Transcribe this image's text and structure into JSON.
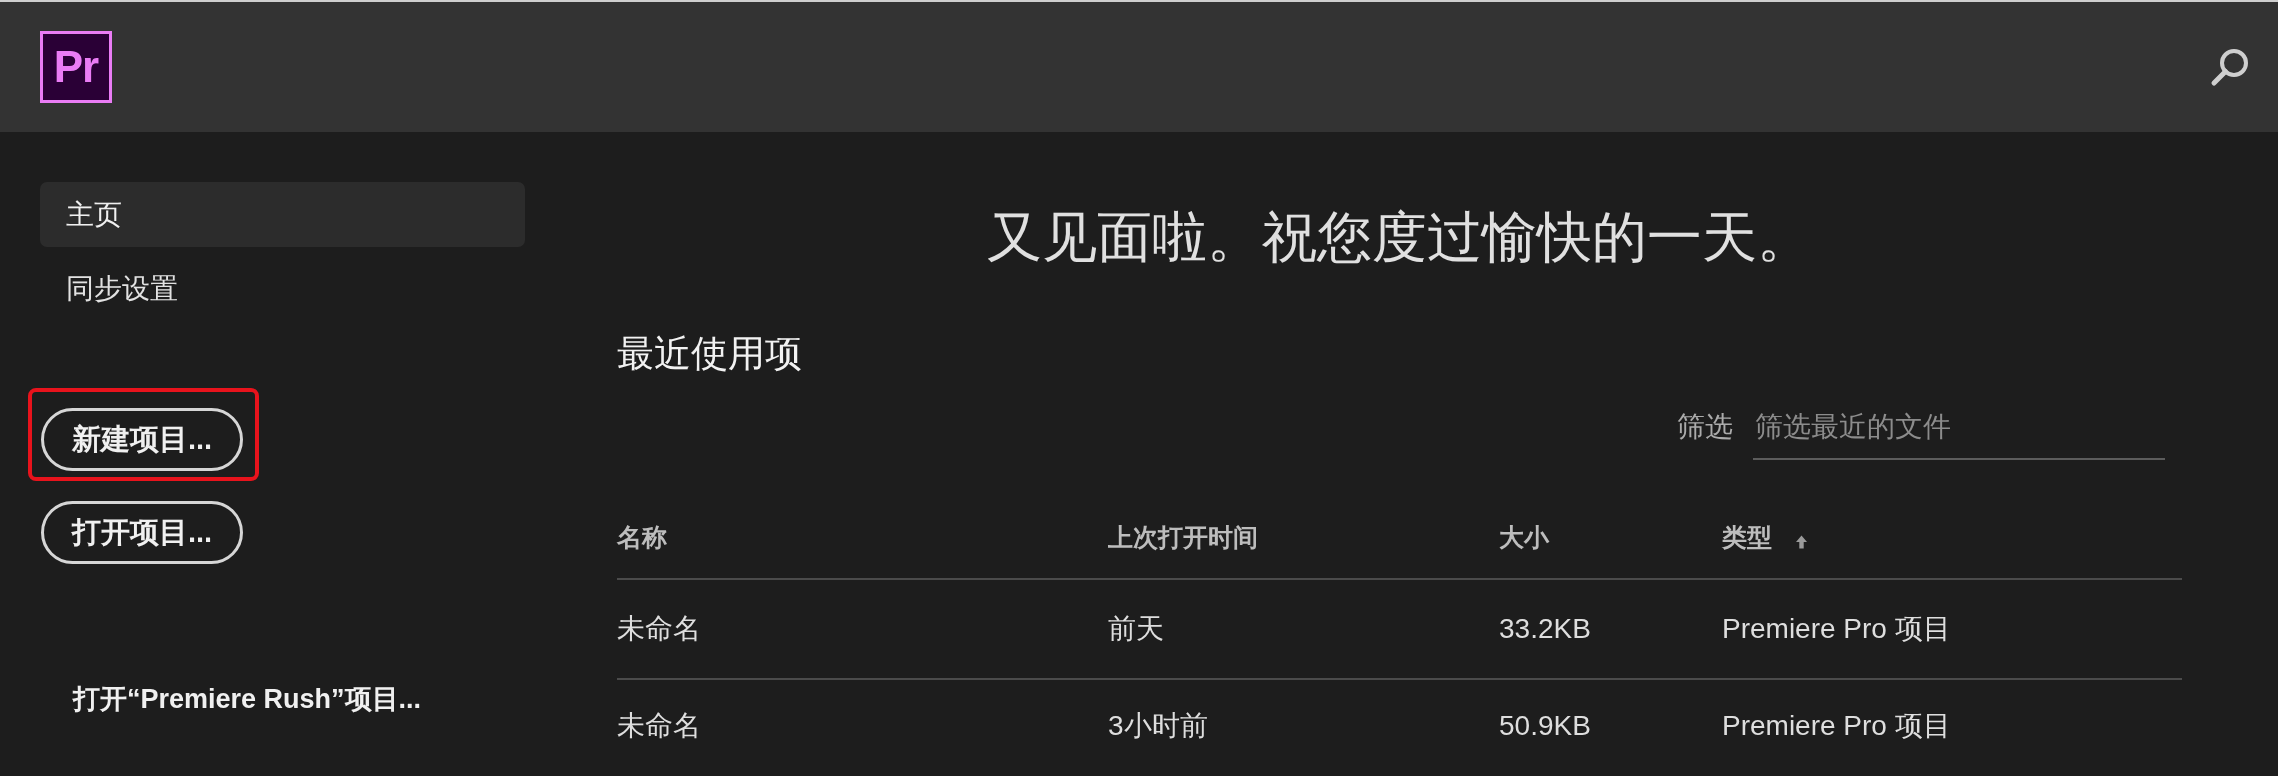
{
  "header": {
    "logo_text": "Pr"
  },
  "sidebar": {
    "nav_items": [
      {
        "label": "主页",
        "selected": true
      },
      {
        "label": "同步设置",
        "selected": false
      }
    ],
    "buttons": [
      {
        "label": "新建项目...",
        "highlighted": true
      },
      {
        "label": "打开项目...",
        "highlighted": false
      }
    ],
    "rush_link": "打开“Premiere Rush”项目..."
  },
  "main": {
    "greeting": "又见面啦。祝您度过愉快的一天。",
    "recent_title": "最近使用项",
    "filter": {
      "label": "筛选",
      "placeholder": "筛选最近的文件"
    },
    "table": {
      "columns": [
        {
          "label": "名称",
          "sorted": false
        },
        {
          "label": "上次打开时间",
          "sorted": false
        },
        {
          "label": "大小",
          "sorted": false
        },
        {
          "label": "类型",
          "sorted": true
        }
      ],
      "rows": [
        [
          "未命名",
          "前天",
          "33.2KB",
          "Premiere Pro 项目"
        ],
        [
          "未命名",
          "3小时前",
          "50.9KB",
          "Premiere Pro 项目"
        ]
      ]
    }
  }
}
